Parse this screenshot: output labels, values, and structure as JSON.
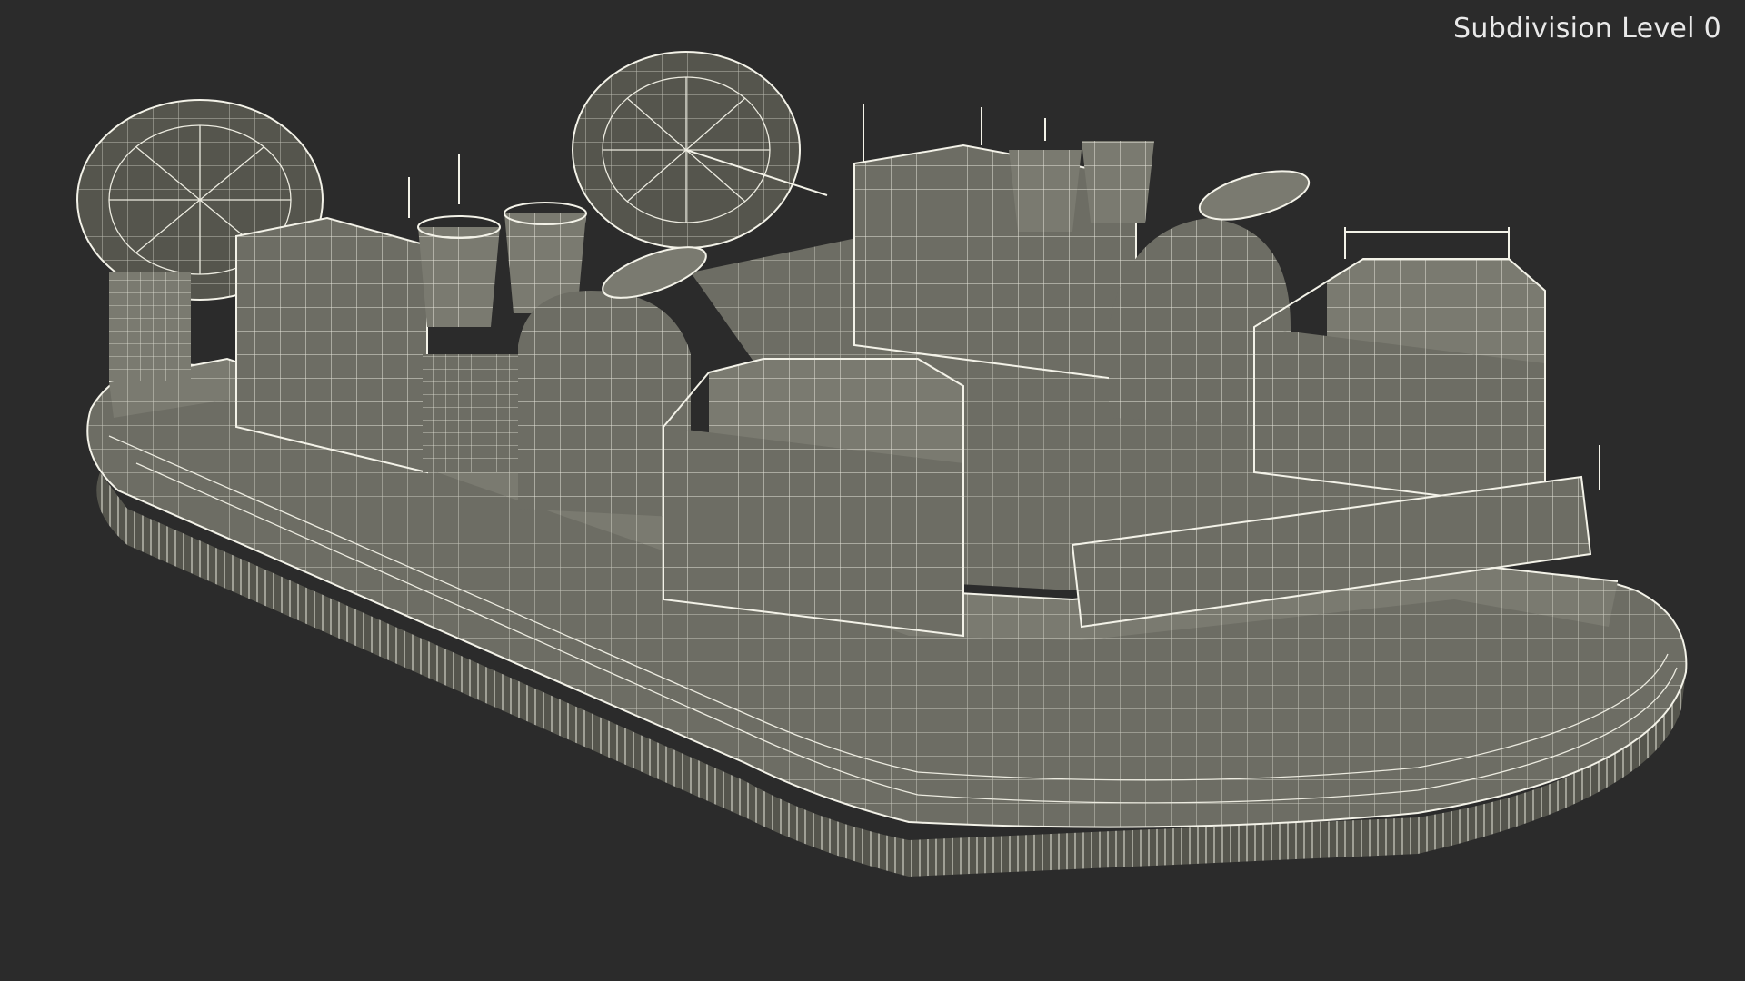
{
  "viewport": {
    "subdivision_label": "Subdivision Level 0"
  },
  "colors": {
    "background": "#2b2b2b",
    "model_fill": "#6d6d64",
    "wireframe": "#ecebe0",
    "label_text": "#e9e9e9"
  },
  "model": {
    "subject": "hovercraft-wireframe",
    "icon": "hovercraft-wireframe-render"
  }
}
